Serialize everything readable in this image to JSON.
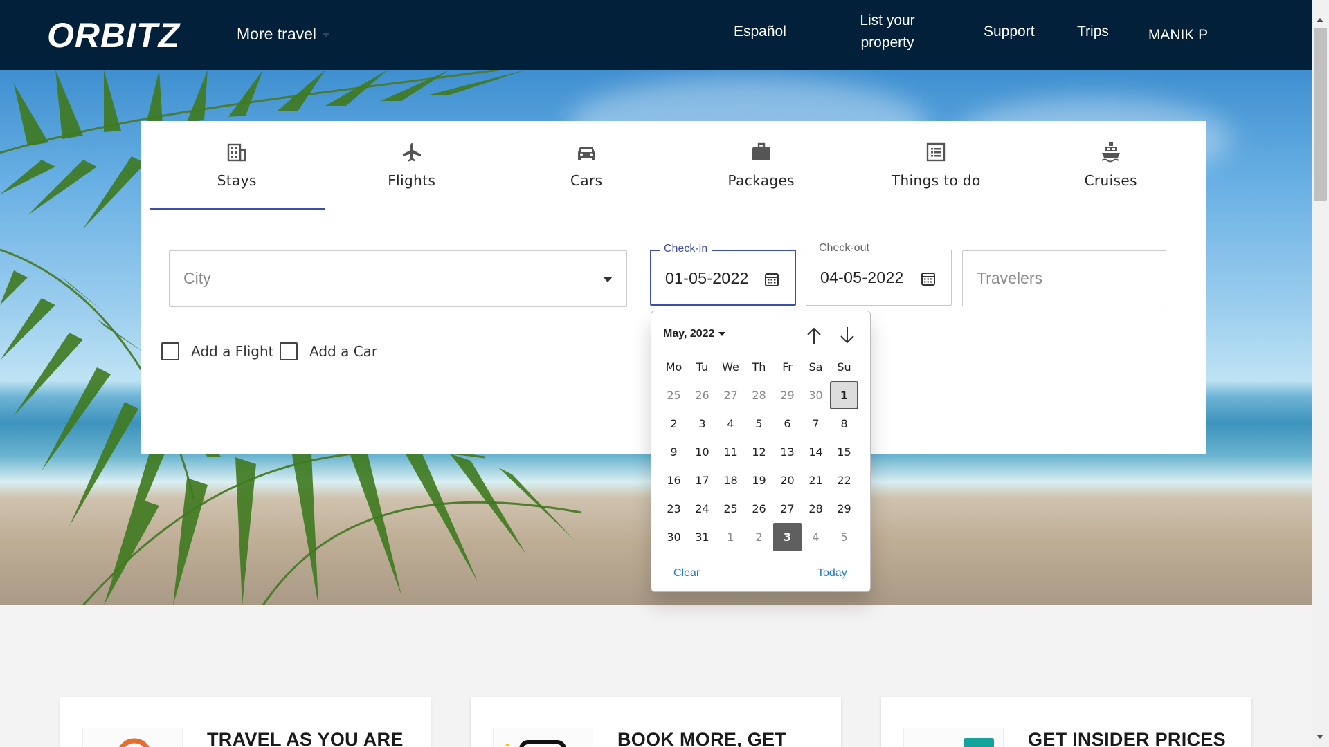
{
  "brand": {
    "logo_text": "ORBITZ"
  },
  "nav": {
    "more_travel": "More travel",
    "links": [
      {
        "label": "Español"
      },
      {
        "label": "List your property"
      },
      {
        "label": "Support"
      },
      {
        "label": "Trips"
      }
    ],
    "user": "MANIK P"
  },
  "tabs": [
    {
      "label": "Stays",
      "icon": "building-icon",
      "active": true
    },
    {
      "label": "Flights",
      "icon": "plane-icon"
    },
    {
      "label": "Cars",
      "icon": "car-icon"
    },
    {
      "label": "Packages",
      "icon": "suitcase-icon"
    },
    {
      "label": "Things to do",
      "icon": "list-icon"
    },
    {
      "label": "Cruises",
      "icon": "ship-icon"
    }
  ],
  "search": {
    "city_placeholder": "City",
    "checkin": {
      "label": "Check-in",
      "value": "01-05-2022"
    },
    "checkout": {
      "label": "Check-out",
      "value": "04-05-2022"
    },
    "travelers_placeholder": "Travelers",
    "add_flight": "Add a Flight",
    "add_car": "Add a Car"
  },
  "datepicker": {
    "month_label": "May, 2022",
    "weekdays": [
      "Mo",
      "Tu",
      "We",
      "Th",
      "Fr",
      "Sa",
      "Su"
    ],
    "weeks": [
      [
        "25",
        "26",
        "27",
        "28",
        "29",
        "30",
        "1"
      ],
      [
        "2",
        "3",
        "4",
        "5",
        "6",
        "7",
        "8"
      ],
      [
        "9",
        "10",
        "11",
        "12",
        "13",
        "14",
        "15"
      ],
      [
        "16",
        "17",
        "18",
        "19",
        "20",
        "21",
        "22"
      ],
      [
        "23",
        "24",
        "25",
        "26",
        "27",
        "28",
        "29"
      ],
      [
        "30",
        "31",
        "1",
        "2",
        "3",
        "4",
        "5"
      ]
    ],
    "today_day": "1",
    "selected_day": "3",
    "clear_label": "Clear",
    "today_label": "Today"
  },
  "promos": [
    {
      "title": "TRAVEL AS YOU ARE"
    },
    {
      "title": "BOOK MORE, GET"
    },
    {
      "title": "GET INSIDER PRICES"
    }
  ],
  "colors": {
    "nav_bg": "#03203a",
    "accent": "#3e4fa8",
    "link": "#1976d2"
  }
}
